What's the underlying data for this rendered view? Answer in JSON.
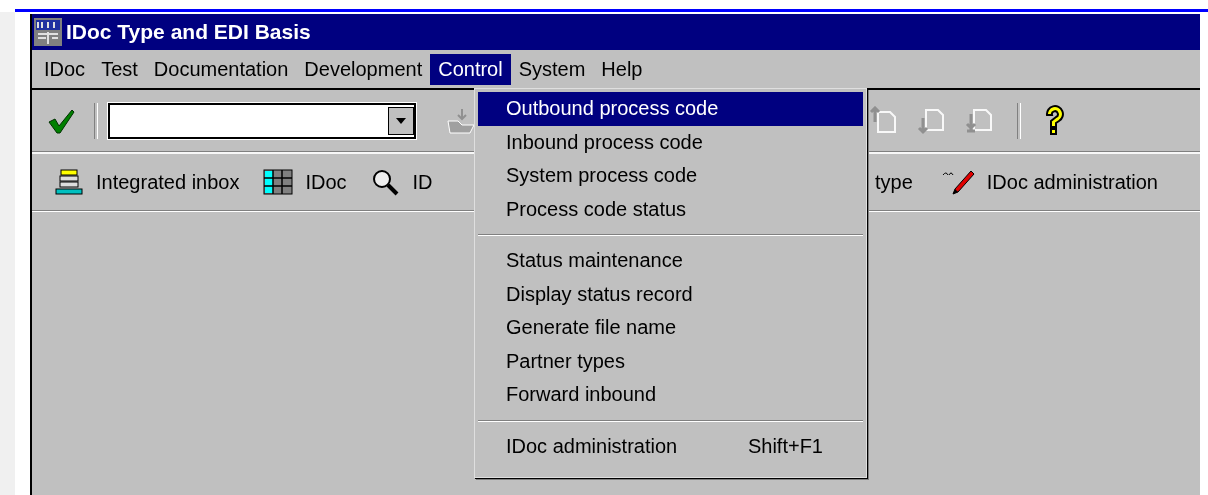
{
  "window": {
    "title": "IDoc Type and EDI Basis"
  },
  "menu_bar": [
    {
      "label": "IDoc",
      "selected": false
    },
    {
      "label": "Test",
      "selected": false
    },
    {
      "label": "Documentation",
      "selected": false
    },
    {
      "label": "Development",
      "selected": false
    },
    {
      "label": "Control",
      "selected": true
    },
    {
      "label": "System",
      "selected": false
    },
    {
      "label": "Help",
      "selected": false
    }
  ],
  "dropdown": {
    "items": [
      {
        "kind": "item",
        "label": "Outbound process code",
        "selected": true
      },
      {
        "kind": "item",
        "label": "Inbound process code",
        "selected": false
      },
      {
        "kind": "item",
        "label": "System process code",
        "selected": false
      },
      {
        "kind": "item",
        "label": "Process code status",
        "selected": false
      },
      {
        "kind": "separator"
      },
      {
        "kind": "item",
        "label": "Status maintenance",
        "selected": false
      },
      {
        "kind": "item",
        "label": "Display status record",
        "selected": false
      },
      {
        "kind": "item",
        "label": "Generate file name",
        "selected": false
      },
      {
        "kind": "item",
        "label": "Partner types",
        "selected": false
      },
      {
        "kind": "item",
        "label": "Forward inbound",
        "selected": false
      },
      {
        "kind": "separator"
      },
      {
        "kind": "item",
        "label": "IDoc administration",
        "shortcut": "Shift+F1",
        "selected": false
      }
    ]
  },
  "app_toolbar": {
    "left": [
      {
        "kind": "inbox",
        "label": "Integrated inbox"
      },
      {
        "kind": "grid",
        "label": "IDoc"
      },
      {
        "kind": "magnifier",
        "label": "ID"
      }
    ],
    "right": [
      {
        "kind": "text",
        "label": "type"
      },
      {
        "kind": "pencil",
        "label": "IDoc administration"
      }
    ]
  }
}
